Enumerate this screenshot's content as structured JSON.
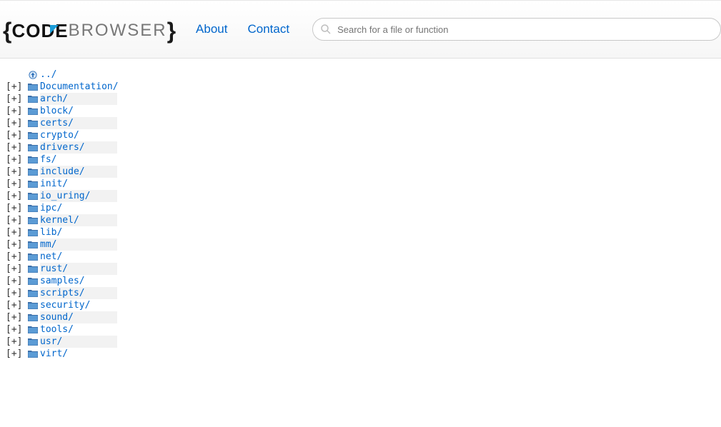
{
  "header": {
    "logo_code": "CODE",
    "logo_browser": "BROWSER",
    "nav": {
      "about": "About",
      "contact": "Contact"
    },
    "search": {
      "placeholder": "Search for a file or function"
    }
  },
  "listing": {
    "parent": "../",
    "items": [
      {
        "name": "Documentation/",
        "expand": "[+]"
      },
      {
        "name": "arch/",
        "expand": "[+]"
      },
      {
        "name": "block/",
        "expand": "[+]"
      },
      {
        "name": "certs/",
        "expand": "[+]"
      },
      {
        "name": "crypto/",
        "expand": "[+]"
      },
      {
        "name": "drivers/",
        "expand": "[+]"
      },
      {
        "name": "fs/",
        "expand": "[+]"
      },
      {
        "name": "include/",
        "expand": "[+]"
      },
      {
        "name": "init/",
        "expand": "[+]"
      },
      {
        "name": "io_uring/",
        "expand": "[+]"
      },
      {
        "name": "ipc/",
        "expand": "[+]"
      },
      {
        "name": "kernel/",
        "expand": "[+]"
      },
      {
        "name": "lib/",
        "expand": "[+]"
      },
      {
        "name": "mm/",
        "expand": "[+]"
      },
      {
        "name": "net/",
        "expand": "[+]"
      },
      {
        "name": "rust/",
        "expand": "[+]"
      },
      {
        "name": "samples/",
        "expand": "[+]"
      },
      {
        "name": "scripts/",
        "expand": "[+]"
      },
      {
        "name": "security/",
        "expand": "[+]"
      },
      {
        "name": "sound/",
        "expand": "[+]"
      },
      {
        "name": "tools/",
        "expand": "[+]"
      },
      {
        "name": "usr/",
        "expand": "[+]"
      },
      {
        "name": "virt/",
        "expand": "[+]"
      }
    ]
  }
}
